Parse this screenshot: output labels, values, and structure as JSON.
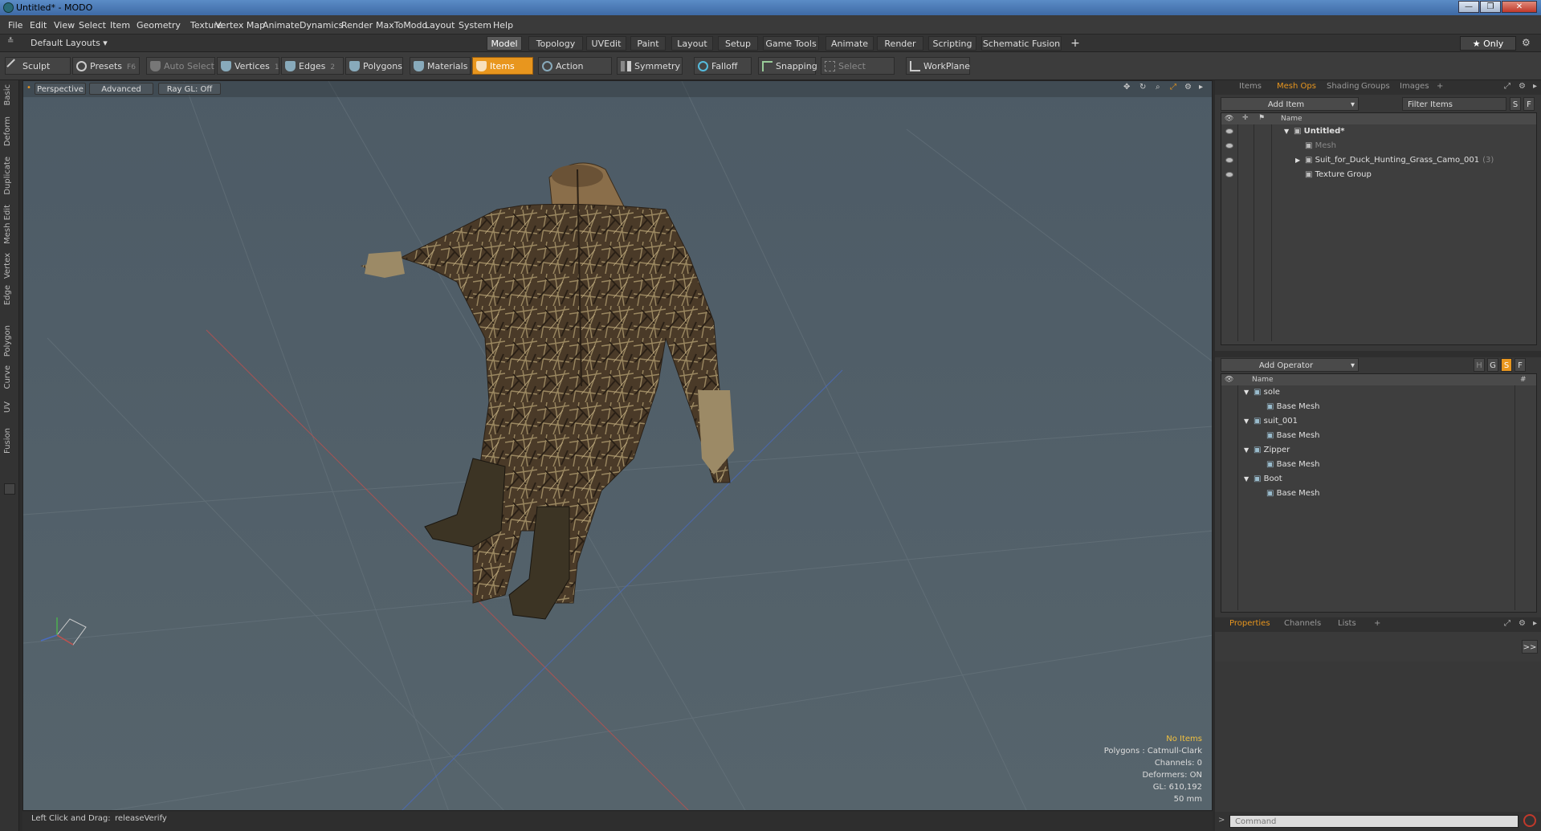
{
  "window": {
    "title": "Untitled* - MODO",
    "min": "—",
    "max": "❐",
    "close": "✕"
  },
  "menu": [
    "File",
    "Edit",
    "View",
    "Select",
    "Item",
    "Geometry",
    "Texture",
    "Vertex Map",
    "Animate",
    "Dynamics",
    "Render",
    "MaxToModo",
    "Layout",
    "System",
    "Help"
  ],
  "layouts": {
    "label": "Default Layouts ▾",
    "only": "★  Only"
  },
  "modetabs": [
    "Model",
    "Topology",
    "UVEdit",
    "Paint",
    "Layout",
    "Setup",
    "Game Tools",
    "Animate",
    "Render",
    "Scripting",
    "Schematic Fusion",
    "+"
  ],
  "toolbar": {
    "sculpt": "Sculpt",
    "presets": "Presets",
    "presets_key": "F6",
    "autoselect": "Auto Select",
    "vertices": "Vertices",
    "vertices_key": "1",
    "edges": "Edges",
    "edges_key": "2",
    "polygons": "Polygons",
    "materials": "Materials",
    "items": "Items",
    "action_center": "Action Center",
    "symmetry": "Symmetry",
    "falloff": "Falloff",
    "snapping": "Snapping",
    "select_through": "Select Through",
    "workplane": "WorkPlane"
  },
  "lefttabs": [
    "Basic",
    "Deform",
    "Duplicate",
    "Mesh Edit",
    "Vertex",
    "Edge",
    "Polygon",
    "Curve",
    "UV",
    "Fusion"
  ],
  "viewport": {
    "perspective": "Perspective",
    "advanced": "Advanced",
    "raygl": "Ray GL: Off",
    "hud": {
      "no_items": "No Items",
      "polygons": "Polygons : Catmull-Clark",
      "channels": "Channels: 0",
      "deformers": "Deformers: ON",
      "gl": "GL: 610,192",
      "size": "50 mm"
    },
    "colors": {
      "bg": "#4a5862",
      "grid": "#6b7880",
      "xaxis": "#c0504d",
      "zaxis": "#4a6cc0"
    }
  },
  "status": {
    "left": "Left Click and Drag:",
    "action": "releaseVerify"
  },
  "items_panel": {
    "tabs": [
      "Items",
      "Mesh Ops",
      "Shading",
      "Groups",
      "Images",
      "+"
    ],
    "add_item": "Add Item",
    "filter": "Filter Items",
    "s": "S",
    "f": "F",
    "col_name": "Name",
    "rows": [
      {
        "label": "Untitled*",
        "indent": 0,
        "bold": true,
        "arrow": "▼"
      },
      {
        "label": "Mesh",
        "indent": 1,
        "dim": true,
        "arrow": ""
      },
      {
        "label": "Suit_for_Duck_Hunting_Grass_Camo_001",
        "count": "(3)",
        "indent": 1,
        "arrow": "▶"
      },
      {
        "label": "Texture Group",
        "indent": 1,
        "arrow": ""
      }
    ]
  },
  "operators_panel": {
    "add_operator": "Add Operator",
    "h": "H",
    "g": "G",
    "s": "S",
    "f": "F",
    "col_name": "Name",
    "col_hash": "#",
    "rows": [
      {
        "label": "sole",
        "indent": 0,
        "arrow": "▼"
      },
      {
        "label": "Base Mesh",
        "indent": 1,
        "arrow": ""
      },
      {
        "label": "suit_001",
        "indent": 0,
        "arrow": "▼"
      },
      {
        "label": "Base Mesh",
        "indent": 1,
        "arrow": ""
      },
      {
        "label": "Zipper",
        "indent": 0,
        "arrow": "▼"
      },
      {
        "label": "Base Mesh",
        "indent": 1,
        "arrow": ""
      },
      {
        "label": "Boot",
        "indent": 0,
        "arrow": "▼"
      },
      {
        "label": "Base Mesh",
        "indent": 1,
        "arrow": ""
      }
    ]
  },
  "props_panel": {
    "tabs": [
      "Properties",
      "Channels",
      "Lists",
      "+"
    ],
    "expand": ">>"
  },
  "command": {
    "placeholder": "Command",
    "prompt": ">"
  }
}
